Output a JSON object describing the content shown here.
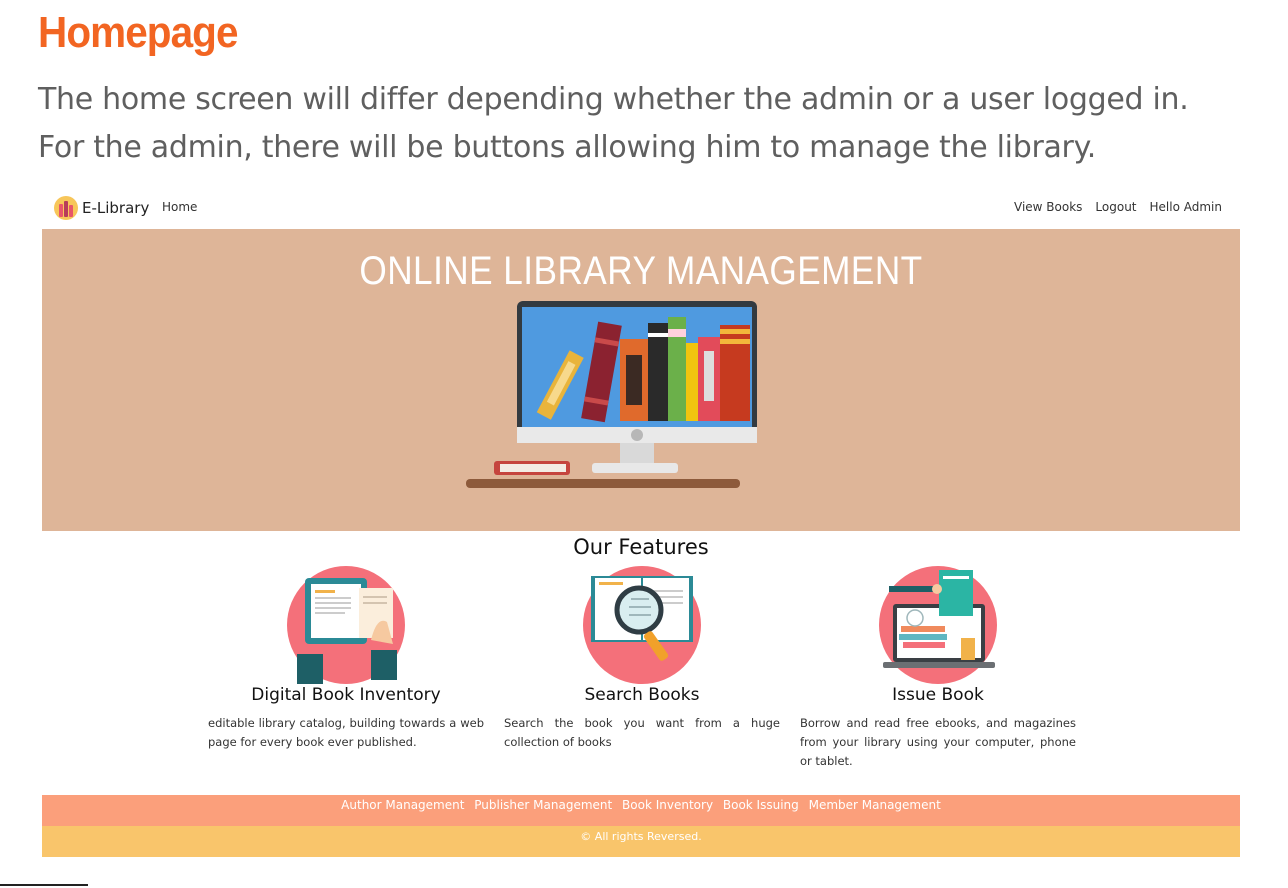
{
  "slide": {
    "title": "Homepage",
    "line1": "The home screen will differ depending whether the admin or a user logged in.",
    "line2": "For the admin, there will be buttons allowing him to manage the library."
  },
  "navbar": {
    "brand": "E-Library",
    "brand_icon": "books-logo-icon",
    "home": "Home",
    "view_books": "View Books",
    "logout": "Logout",
    "greeting": "Hello Admin"
  },
  "hero": {
    "title": "ONLINE LIBRARY MANAGEMENT",
    "background": "#deb598",
    "image_icon": "monitor-bookshelf-icon"
  },
  "features": {
    "title": "Our Features",
    "items": [
      {
        "title": "Digital Book Inventory",
        "desc": "editable library catalog, building towards a web page for every book ever published.",
        "icon": "tablet-book-icon"
      },
      {
        "title": "Search Books",
        "desc": "Search the book you want from a huge collection of books",
        "icon": "magnifier-book-icon"
      },
      {
        "title": "Issue Book",
        "desc": "Borrow and read free ebooks, and magazines from your library using your computer, phone or tablet.",
        "icon": "laptop-books-icon"
      }
    ]
  },
  "footer": {
    "links": [
      "Author Management",
      "Publisher Management",
      "Book Inventory",
      "Book Issuing",
      "Member Management"
    ],
    "copyright": "© All rights Reversed.",
    "colors": {
      "links_bar": "#fb9f7b",
      "copyright_bar": "#f9c56b"
    }
  },
  "colors": {
    "title_accent": "#f26522"
  }
}
